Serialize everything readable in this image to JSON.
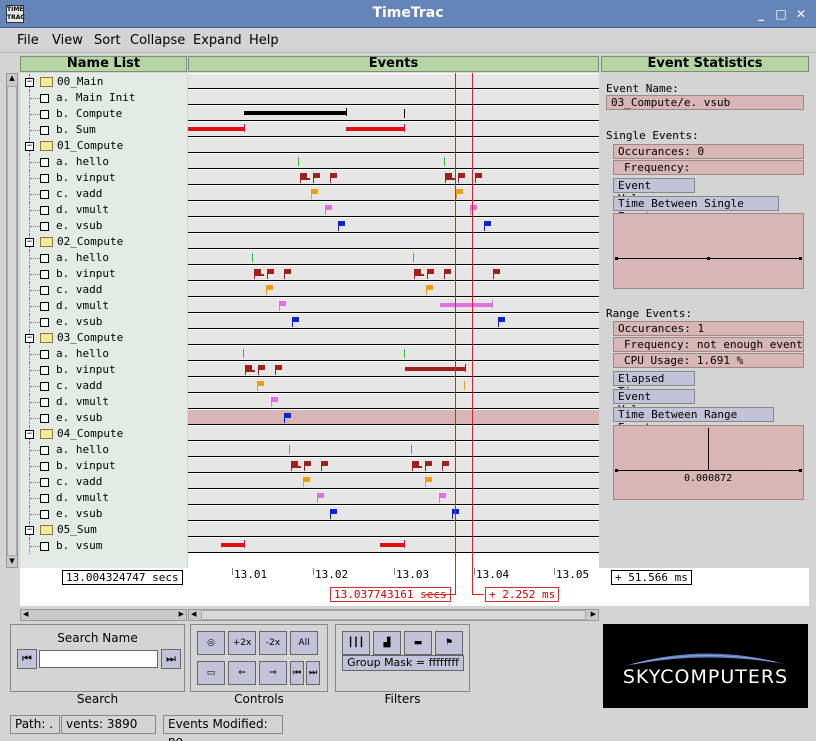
{
  "window": {
    "title": "TimeTrac",
    "icon_text": "TIME TRAC"
  },
  "menu": [
    "File",
    "View",
    "Sort",
    "Collapse",
    "Expand",
    "Help"
  ],
  "panels": {
    "names": "Name List",
    "events": "Events",
    "stats": "Event Statistics"
  },
  "tree": [
    {
      "type": "group",
      "label": "00_Main"
    },
    {
      "type": "item",
      "label": "a. Main Init"
    },
    {
      "type": "item",
      "label": "b. Compute"
    },
    {
      "type": "item",
      "label": "b. Sum"
    },
    {
      "type": "group",
      "label": "01_Compute"
    },
    {
      "type": "item",
      "label": "a. hello"
    },
    {
      "type": "item",
      "label": "b. vinput"
    },
    {
      "type": "item",
      "label": "c. vadd"
    },
    {
      "type": "item",
      "label": "d. vmult"
    },
    {
      "type": "item",
      "label": "e. vsub"
    },
    {
      "type": "group",
      "label": "02_Compute"
    },
    {
      "type": "item",
      "label": "a. hello"
    },
    {
      "type": "item",
      "label": "b. vinput"
    },
    {
      "type": "item",
      "label": "c. vadd"
    },
    {
      "type": "item",
      "label": "d. vmult"
    },
    {
      "type": "item",
      "label": "e. vsub"
    },
    {
      "type": "group",
      "label": "03_Compute"
    },
    {
      "type": "item",
      "label": "a. hello"
    },
    {
      "type": "item",
      "label": "b. vinput"
    },
    {
      "type": "item",
      "label": "c. vadd"
    },
    {
      "type": "item",
      "label": "d. vmult"
    },
    {
      "type": "item",
      "label": "e. vsub"
    },
    {
      "type": "group",
      "label": "04_Compute"
    },
    {
      "type": "item",
      "label": "a. hello"
    },
    {
      "type": "item",
      "label": "b. vinput"
    },
    {
      "type": "item",
      "label": "c. vadd"
    },
    {
      "type": "item",
      "label": "d. vmult"
    },
    {
      "type": "item",
      "label": "e. vsub"
    },
    {
      "type": "group",
      "label": "05_Sum"
    },
    {
      "type": "item",
      "label": "b. vsum"
    }
  ],
  "colors": {
    "hello": "#30c030",
    "vinput": "#a02020",
    "vadd": "#f0a000",
    "vmult": "#e070e0",
    "vsub": "#1020e0",
    "compute": "#000000",
    "sum": "#e01010",
    "selected_row": "#d8b6b6",
    "cursor": "#e02020"
  },
  "stats": {
    "event_name_label": "Event Name:",
    "event_name": "03_Compute/e. vsub",
    "single_label": "Single Events:",
    "single_occ": "Occurances: 0",
    "single_freq": "Frequency:",
    "btn_event_values": "Event Values",
    "btn_time_between_single": "Time Between Single Events",
    "range_label": "Range Events:",
    "range_occ": "Occurances: 1",
    "range_freq": "Frequency: not enough events",
    "range_cpu": "CPU Usage: 1.691 %",
    "btn_elapsed": "Elapsed Time",
    "btn_event_values2": "Event Values",
    "btn_time_between_range": "Time Between Range Events",
    "plot_value": "0.000872"
  },
  "timeline": {
    "start": "13.004324747 secs",
    "end": "+ 51.566 ms",
    "ticks": [
      "13.01",
      "13.02",
      "13.03",
      "13.04",
      "13.05"
    ],
    "cursor": "13.037743161 secs",
    "delta": "+ 2.252 ms"
  },
  "search": {
    "title": "Search Name",
    "value": "",
    "label": "Search"
  },
  "controls": {
    "label": "Controls",
    "zoom_in": "+2x",
    "zoom_out": "-2x",
    "all": "All"
  },
  "filters": {
    "label": "Filters",
    "group_mask": "Group Mask = ffffffff"
  },
  "logo": "SKYCOMPUTERS",
  "status": {
    "path": "Path: .",
    "events": "vents: 3890",
    "modified": "Events Modified: no"
  }
}
